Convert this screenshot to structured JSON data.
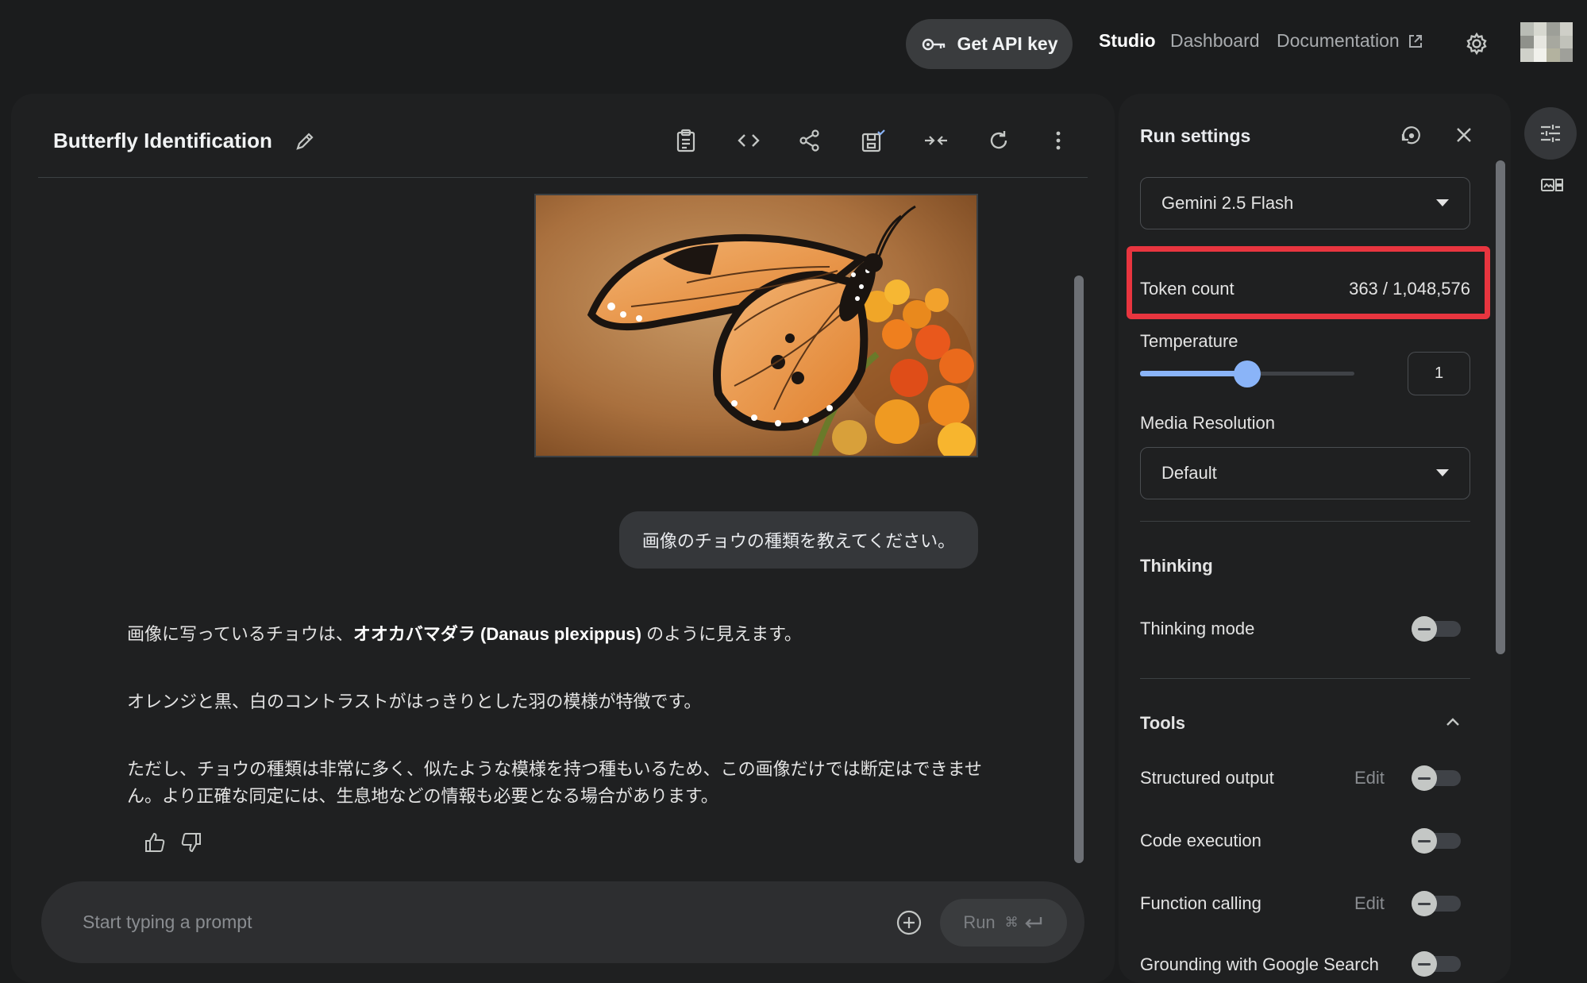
{
  "header": {
    "api_key_label": "Get API key",
    "nav": {
      "studio": "Studio",
      "dashboard": "Dashboard",
      "documentation": "Documentation"
    }
  },
  "prompt": {
    "title": "Butterfly Identification",
    "toolbar_icons": [
      "clipboard-icon",
      "code-icon",
      "share-icon",
      "save-icon",
      "compare-icon",
      "refresh-icon",
      "more-icon"
    ]
  },
  "chat": {
    "user_message": "画像のチョウの種類を教えてください。",
    "response": {
      "p1_before": "画像に写っているチョウは、",
      "p1_bold": "オオカバマダラ (Danaus plexippus)",
      "p1_after": " のように見えます。",
      "p2": "オレンジと黒、白のコントラストがはっきりとした羽の模様が特徴です。",
      "p3": "ただし、チョウの種類は非常に多く、似たような模様を持つ種もいるため、この画像だけでは断定はできません。より正確な同定には、生息地などの情報も必要となる場合があります。"
    }
  },
  "input": {
    "placeholder": "Start typing a prompt",
    "run_label": "Run",
    "run_shortcut": "⌘"
  },
  "settings": {
    "title": "Run settings",
    "model": "Gemini 2.5 Flash",
    "token_count_label": "Token count",
    "token_count_value": "363 / 1,048,576",
    "temperature_label": "Temperature",
    "temperature_value": "1",
    "temperature_fraction": 0.5,
    "media_resolution_label": "Media Resolution",
    "media_resolution_value": "Default",
    "thinking_title": "Thinking",
    "thinking_mode_label": "Thinking mode",
    "tools_title": "Tools",
    "tools": [
      {
        "label": "Structured output",
        "edit": "Edit"
      },
      {
        "label": "Code execution"
      },
      {
        "label": "Function calling",
        "edit": "Edit"
      },
      {
        "label": "Grounding with Google Search"
      }
    ]
  },
  "colors": {
    "accent": "#8ab4f8",
    "highlight": "#e8353f",
    "background": "#1b1c1d",
    "panel": "#1f2021"
  }
}
